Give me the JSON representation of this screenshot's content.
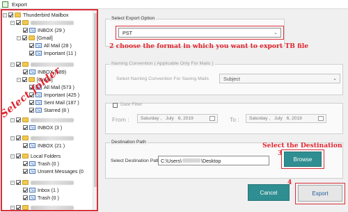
{
  "window": {
    "title": "Export"
  },
  "tree": {
    "root_label": "Thunderbird Mailbox",
    "inbox1": "INBOX (29 )",
    "gmail1": "[Gmail]",
    "allmail1": "All Mail (28 )",
    "important1": "Important (11 )",
    "inbox2": "INBOX (589)",
    "gmail2": "[Gmail]",
    "allmail2": "All Mail (573 )",
    "important2": "Important (425 )",
    "sentmail2": "Sent Mail (187 )",
    "starred2": "Starred (8 )",
    "inbox3": "INBOX (3 )",
    "inbox4": "INBOX (21 )",
    "local_folders": "Local Folders",
    "trash1": "Trash (0 )",
    "unsent": "Unsent Messages (0",
    "inbox5": "Inbox (1 )",
    "trash2": "Trash (0 )",
    "overlay": "Select folder"
  },
  "export_option": {
    "legend": "Select Export Option",
    "value": "PST",
    "annotation": "2 choose the format in which you want to export TB file"
  },
  "naming": {
    "legend": "Naming Convention ( Applicable Only For Mails )",
    "label": "Select Naming Convention For Saving Mails",
    "value": "Subject"
  },
  "date_filter": {
    "label": "Date Filter",
    "from_label": "From :",
    "to_label": "To :",
    "from": {
      "day": "Saturday ,",
      "month": "July",
      "date": "6, 2019"
    },
    "to": {
      "day": "Saturday ,",
      "month": "July",
      "date": "6, 2019"
    }
  },
  "destination": {
    "legend": "Destination Path",
    "label": "Select Destination Path",
    "path_prefix": "C:\\Users\\",
    "path_suffix": "\\Desktop",
    "browse": "Browse",
    "annotation": "Select the Destination",
    "step3": "3"
  },
  "actions": {
    "cancel": "Cancel",
    "export": "Export",
    "step4": "4"
  },
  "colors": {
    "teal": "#2f8e91",
    "annotation_red": "#e0242e"
  }
}
